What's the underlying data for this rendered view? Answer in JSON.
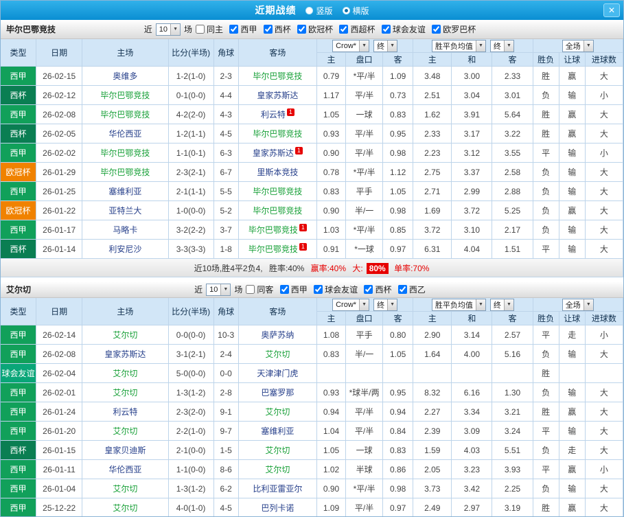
{
  "topbar": {
    "title": "近期战绩",
    "radios": [
      {
        "label": "竖版",
        "selected": false
      },
      {
        "label": "横版",
        "selected": true
      }
    ],
    "close_label": "✕"
  },
  "colors": {
    "topbar_blue": "#0d8fd0",
    "league_liga": "#11a05a",
    "league_copa": "#0a7e52",
    "league_ucl": "#f08200",
    "league_friendly": "#0aa678",
    "tone_red": "#e60000",
    "tone_blue": "#1e50c8",
    "tone_green": "#18a038",
    "badge_red": "#e60000"
  },
  "sections": [
    {
      "team_title": "毕尔巴鄂竞技",
      "filter": {
        "prefix": "近",
        "count": "10",
        "suffix": "场",
        "checkboxes": [
          {
            "label": "同主",
            "checked": false
          },
          {
            "label": "西甲",
            "checked": true
          },
          {
            "label": "西杯",
            "checked": true
          },
          {
            "label": "欧冠杯",
            "checked": true
          },
          {
            "label": "西超杯",
            "checked": true
          },
          {
            "label": "球会友谊",
            "checked": true
          },
          {
            "label": "欧罗巴杯",
            "checked": true
          }
        ]
      },
      "header": {
        "type": "类型",
        "date": "日期",
        "home": "主场",
        "score": "比分(半场)",
        "corner": "角球",
        "away": "客场",
        "book_select": "Crow*",
        "final_select": "终",
        "avg_select": "胜平负均值",
        "final_select2": "终",
        "scope_select": "全场",
        "odds_home": "主",
        "odds_line": "盘口",
        "odds_away": "客",
        "avg_home": "主",
        "avg_draw": "和",
        "avg_away": "客",
        "result": "胜负",
        "handicap": "让球",
        "goals": "进球数"
      },
      "rows": [
        {
          "league": "西甲",
          "league_key": "liga",
          "date": "26-02-15",
          "home": "奥维多",
          "home_side": "opp",
          "home_badge": "",
          "score": "1-2(1-0)",
          "score_tone": "red",
          "corners": "2-3",
          "away": "毕尔巴鄂竞技",
          "away_side": "self",
          "away_badge": "",
          "odds_home": "0.79",
          "line": "*平/半",
          "odds_away": "1.09",
          "avg_home": "3.48",
          "avg_draw": "3.00",
          "avg_away": "2.33",
          "result": "胜",
          "result_tone": "red",
          "handicap": "赢",
          "handicap_tone": "red",
          "goals": "大",
          "goals_tone": "red"
        },
        {
          "league": "西杯",
          "league_key": "copa",
          "date": "26-02-12",
          "home": "毕尔巴鄂竞技",
          "home_side": "self",
          "home_badge": "",
          "score": "0-1(0-0)",
          "score_tone": "red",
          "corners": "4-4",
          "away": "皇家苏斯达",
          "away_side": "opp",
          "away_badge": "",
          "odds_home": "1.17",
          "line": "平/半",
          "odds_away": "0.73",
          "avg_home": "2.51",
          "avg_draw": "3.04",
          "avg_away": "3.01",
          "result": "负",
          "result_tone": "green",
          "handicap": "输",
          "handicap_tone": "green",
          "goals": "小",
          "goals_tone": "green"
        },
        {
          "league": "西甲",
          "league_key": "liga",
          "date": "26-02-08",
          "home": "毕尔巴鄂竞技",
          "home_side": "self",
          "home_badge": "",
          "score": "4-2(2-0)",
          "score_tone": "red",
          "corners": "4-3",
          "away": "利云特",
          "away_side": "opp",
          "away_badge": "1",
          "odds_home": "1.05",
          "line": "一球",
          "odds_away": "0.83",
          "avg_home": "1.62",
          "avg_draw": "3.91",
          "avg_away": "5.64",
          "result": "胜",
          "result_tone": "red",
          "handicap": "赢",
          "handicap_tone": "red",
          "goals": "大",
          "goals_tone": "red"
        },
        {
          "league": "西杯",
          "league_key": "copa",
          "date": "26-02-05",
          "home": "华伦西亚",
          "home_side": "opp",
          "home_badge": "",
          "score": "1-2(1-1)",
          "score_tone": "red",
          "corners": "4-5",
          "away": "毕尔巴鄂竞技",
          "away_side": "self",
          "away_badge": "",
          "odds_home": "0.93",
          "line": "平/半",
          "odds_away": "0.95",
          "avg_home": "2.33",
          "avg_draw": "3.17",
          "avg_away": "3.22",
          "result": "胜",
          "result_tone": "red",
          "handicap": "赢",
          "handicap_tone": "red",
          "goals": "大",
          "goals_tone": "red"
        },
        {
          "league": "西甲",
          "league_key": "liga",
          "date": "26-02-02",
          "home": "毕尔巴鄂竞技",
          "home_side": "self",
          "home_badge": "",
          "score": "1-1(0-1)",
          "score_tone": "blue",
          "corners": "6-3",
          "away": "皇家苏斯达",
          "away_side": "opp",
          "away_badge": "1",
          "odds_home": "0.90",
          "line": "平/半",
          "odds_away": "0.98",
          "avg_home": "2.23",
          "avg_draw": "3.12",
          "avg_away": "3.55",
          "result": "平",
          "result_tone": "blue",
          "handicap": "输",
          "handicap_tone": "green",
          "goals": "小",
          "goals_tone": "green"
        },
        {
          "league": "欧冠杯",
          "league_key": "ucl",
          "date": "26-01-29",
          "home": "毕尔巴鄂竞技",
          "home_side": "self",
          "home_badge": "",
          "score": "2-3(2-1)",
          "score_tone": "red",
          "corners": "6-7",
          "away": "里斯本竞技",
          "away_side": "opp",
          "away_badge": "",
          "odds_home": "0.78",
          "line": "*平/半",
          "odds_away": "1.12",
          "avg_home": "2.75",
          "avg_draw": "3.37",
          "avg_away": "2.58",
          "result": "负",
          "result_tone": "green",
          "handicap": "输",
          "handicap_tone": "green",
          "goals": "大",
          "goals_tone": "red"
        },
        {
          "league": "西甲",
          "league_key": "liga",
          "date": "26-01-25",
          "home": "塞维利亚",
          "home_side": "opp",
          "home_badge": "",
          "score": "2-1(1-1)",
          "score_tone": "red",
          "corners": "5-5",
          "away": "毕尔巴鄂竞技",
          "away_side": "self",
          "away_badge": "",
          "odds_home": "0.83",
          "line": "平手",
          "odds_away": "1.05",
          "avg_home": "2.71",
          "avg_draw": "2.99",
          "avg_away": "2.88",
          "result": "负",
          "result_tone": "green",
          "handicap": "输",
          "handicap_tone": "green",
          "goals": "大",
          "goals_tone": "red"
        },
        {
          "league": "欧冠杯",
          "league_key": "ucl",
          "date": "26-01-22",
          "home": "亚特兰大",
          "home_side": "opp",
          "home_badge": "",
          "score": "1-0(0-0)",
          "score_tone": "red",
          "corners": "5-2",
          "away": "毕尔巴鄂竞技",
          "away_side": "self",
          "away_badge": "",
          "odds_home": "0.90",
          "line": "半/一",
          "odds_away": "0.98",
          "avg_home": "1.69",
          "avg_draw": "3.72",
          "avg_away": "5.25",
          "result": "负",
          "result_tone": "green",
          "handicap": "赢",
          "handicap_tone": "red",
          "goals": "大",
          "goals_tone": "red"
        },
        {
          "league": "西甲",
          "league_key": "liga",
          "date": "26-01-17",
          "home": "马略卡",
          "home_side": "opp",
          "home_badge": "",
          "score": "3-2(2-2)",
          "score_tone": "red",
          "corners": "3-7",
          "away": "毕尔巴鄂竞技",
          "away_side": "self",
          "away_badge": "1",
          "odds_home": "1.03",
          "line": "*平/半",
          "odds_away": "0.85",
          "avg_home": "3.72",
          "avg_draw": "3.10",
          "avg_away": "2.17",
          "result": "负",
          "result_tone": "green",
          "handicap": "输",
          "handicap_tone": "green",
          "goals": "大",
          "goals_tone": "red"
        },
        {
          "league": "西杯",
          "league_key": "copa",
          "date": "26-01-14",
          "home": "利安尼沙",
          "home_side": "opp",
          "home_badge": "",
          "score": "3-3(3-3)",
          "score_tone": "blue",
          "corners": "1-8",
          "away": "毕尔巴鄂竞技",
          "away_side": "self",
          "away_badge": "1",
          "odds_home": "0.91",
          "line": "*一球",
          "odds_away": "0.97",
          "avg_home": "6.31",
          "avg_draw": "4.04",
          "avg_away": "1.51",
          "result": "平",
          "result_tone": "blue",
          "handicap": "输",
          "handicap_tone": "green",
          "goals": "大",
          "goals_tone": "red"
        }
      ],
      "summary": {
        "record": "近10场,胜4平2负4,",
        "win_rate": "胜率:40%",
        "cover_rate": "赢率:40%",
        "big_label": "大:",
        "big_value": "80%",
        "odd_rate": "单率:70%"
      }
    },
    {
      "team_title": "艾尔切",
      "filter": {
        "prefix": "近",
        "count": "10",
        "suffix": "场",
        "checkboxes": [
          {
            "label": "同客",
            "checked": false
          },
          {
            "label": "西甲",
            "checked": true
          },
          {
            "label": "球会友谊",
            "checked": true
          },
          {
            "label": "西杯",
            "checked": true
          },
          {
            "label": "西乙",
            "checked": true
          }
        ]
      },
      "header": {
        "type": "类型",
        "date": "日期",
        "home": "主场",
        "score": "比分(半场)",
        "corner": "角球",
        "away": "客场",
        "book_select": "Crow*",
        "final_select": "终",
        "avg_select": "胜平负均值",
        "final_select2": "终",
        "scope_select": "全场",
        "odds_home": "主",
        "odds_line": "盘口",
        "odds_away": "客",
        "avg_home": "主",
        "avg_draw": "和",
        "avg_away": "客",
        "result": "胜负",
        "handicap": "让球",
        "goals": "进球数"
      },
      "rows": [
        {
          "league": "西甲",
          "league_key": "liga",
          "date": "26-02-14",
          "home": "艾尔切",
          "home_side": "self",
          "home_badge": "",
          "score": "0-0(0-0)",
          "score_tone": "blue",
          "corners": "10-3",
          "away": "奥萨苏纳",
          "away_side": "opp",
          "away_badge": "",
          "odds_home": "1.08",
          "line": "平手",
          "odds_away": "0.80",
          "avg_home": "2.90",
          "avg_draw": "3.14",
          "avg_away": "2.57",
          "result": "平",
          "result_tone": "blue",
          "handicap": "走",
          "handicap_tone": "blue",
          "goals": "小",
          "goals_tone": "green"
        },
        {
          "league": "西甲",
          "league_key": "liga",
          "date": "26-02-08",
          "home": "皇家苏斯达",
          "home_side": "opp",
          "home_badge": "",
          "score": "3-1(2-1)",
          "score_tone": "red",
          "corners": "2-4",
          "away": "艾尔切",
          "away_side": "self",
          "away_badge": "",
          "odds_home": "0.83",
          "line": "半/一",
          "odds_away": "1.05",
          "avg_home": "1.64",
          "avg_draw": "4.00",
          "avg_away": "5.16",
          "result": "负",
          "result_tone": "green",
          "handicap": "输",
          "handicap_tone": "green",
          "goals": "大",
          "goals_tone": "red"
        },
        {
          "league": "球会友谊",
          "league_key": "friendly",
          "date": "26-02-04",
          "home": "艾尔切",
          "home_side": "self",
          "home_badge": "",
          "score": "5-0(0-0)",
          "score_tone": "red",
          "corners": "0-0",
          "away": "天津津门虎",
          "away_side": "opp",
          "away_badge": "",
          "odds_home": "",
          "line": "",
          "odds_away": "",
          "avg_home": "",
          "avg_draw": "",
          "avg_away": "",
          "result": "胜",
          "result_tone": "red",
          "handicap": "",
          "handicap_tone": "",
          "goals": "",
          "goals_tone": ""
        },
        {
          "league": "西甲",
          "league_key": "liga",
          "date": "26-02-01",
          "home": "艾尔切",
          "home_side": "self",
          "home_badge": "",
          "score": "1-3(1-2)",
          "score_tone": "red",
          "corners": "2-8",
          "away": "巴塞罗那",
          "away_side": "opp",
          "away_badge": "",
          "odds_home": "0.93",
          "line": "*球半/两",
          "odds_away": "0.95",
          "avg_home": "8.32",
          "avg_draw": "6.16",
          "avg_away": "1.30",
          "result": "负",
          "result_tone": "green",
          "handicap": "输",
          "handicap_tone": "green",
          "goals": "大",
          "goals_tone": "red"
        },
        {
          "league": "西甲",
          "league_key": "liga",
          "date": "26-01-24",
          "home": "利云特",
          "home_side": "opp",
          "home_badge": "",
          "score": "2-3(2-0)",
          "score_tone": "red",
          "corners": "9-1",
          "away": "艾尔切",
          "away_side": "self",
          "away_badge": "",
          "odds_home": "0.94",
          "line": "平/半",
          "odds_away": "0.94",
          "avg_home": "2.27",
          "avg_draw": "3.34",
          "avg_away": "3.21",
          "result": "胜",
          "result_tone": "red",
          "handicap": "赢",
          "handicap_tone": "red",
          "goals": "大",
          "goals_tone": "red"
        },
        {
          "league": "西甲",
          "league_key": "liga",
          "date": "26-01-20",
          "home": "艾尔切",
          "home_side": "self",
          "home_badge": "",
          "score": "2-2(1-0)",
          "score_tone": "blue",
          "corners": "9-7",
          "away": "塞维利亚",
          "away_side": "opp",
          "away_badge": "",
          "odds_home": "1.04",
          "line": "平/半",
          "odds_away": "0.84",
          "avg_home": "2.39",
          "avg_draw": "3.09",
          "avg_away": "3.24",
          "result": "平",
          "result_tone": "blue",
          "handicap": "输",
          "handicap_tone": "green",
          "goals": "大",
          "goals_tone": "red"
        },
        {
          "league": "西杯",
          "league_key": "copa",
          "date": "26-01-15",
          "home": "皇家贝迪斯",
          "home_side": "opp",
          "home_badge": "",
          "score": "2-1(0-0)",
          "score_tone": "red",
          "corners": "1-5",
          "away": "艾尔切",
          "away_side": "self",
          "away_badge": "",
          "odds_home": "1.05",
          "line": "一球",
          "odds_away": "0.83",
          "avg_home": "1.59",
          "avg_draw": "4.03",
          "avg_away": "5.51",
          "result": "负",
          "result_tone": "green",
          "handicap": "走",
          "handicap_tone": "blue",
          "goals": "大",
          "goals_tone": "red"
        },
        {
          "league": "西甲",
          "league_key": "liga",
          "date": "26-01-11",
          "home": "华伦西亚",
          "home_side": "opp",
          "home_badge": "",
          "score": "1-1(0-0)",
          "score_tone": "blue",
          "corners": "8-6",
          "away": "艾尔切",
          "away_side": "self",
          "away_badge": "",
          "odds_home": "1.02",
          "line": "半球",
          "odds_away": "0.86",
          "avg_home": "2.05",
          "avg_draw": "3.23",
          "avg_away": "3.93",
          "result": "平",
          "result_tone": "blue",
          "handicap": "赢",
          "handicap_tone": "red",
          "goals": "小",
          "goals_tone": "green"
        },
        {
          "league": "西甲",
          "league_key": "liga",
          "date": "26-01-04",
          "home": "艾尔切",
          "home_side": "self",
          "home_badge": "",
          "score": "1-3(1-2)",
          "score_tone": "red",
          "corners": "6-2",
          "away": "比利亚雷亚尔",
          "away_side": "opp",
          "away_badge": "",
          "odds_home": "0.90",
          "line": "*平/半",
          "odds_away": "0.98",
          "avg_home": "3.73",
          "avg_draw": "3.42",
          "avg_away": "2.25",
          "result": "负",
          "result_tone": "green",
          "handicap": "输",
          "handicap_tone": "green",
          "goals": "大",
          "goals_tone": "red"
        },
        {
          "league": "西甲",
          "league_key": "liga",
          "date": "25-12-22",
          "home": "艾尔切",
          "home_side": "self",
          "home_badge": "",
          "score": "4-0(1-0)",
          "score_tone": "red",
          "corners": "4-5",
          "away": "巴列卡诺",
          "away_side": "opp",
          "away_badge": "",
          "odds_home": "1.09",
          "line": "平/半",
          "odds_away": "0.97",
          "avg_home": "2.49",
          "avg_draw": "2.97",
          "avg_away": "3.19",
          "result": "胜",
          "result_tone": "red",
          "handicap": "赢",
          "handicap_tone": "red",
          "goals": "大",
          "goals_tone": "red"
        }
      ]
    }
  ]
}
